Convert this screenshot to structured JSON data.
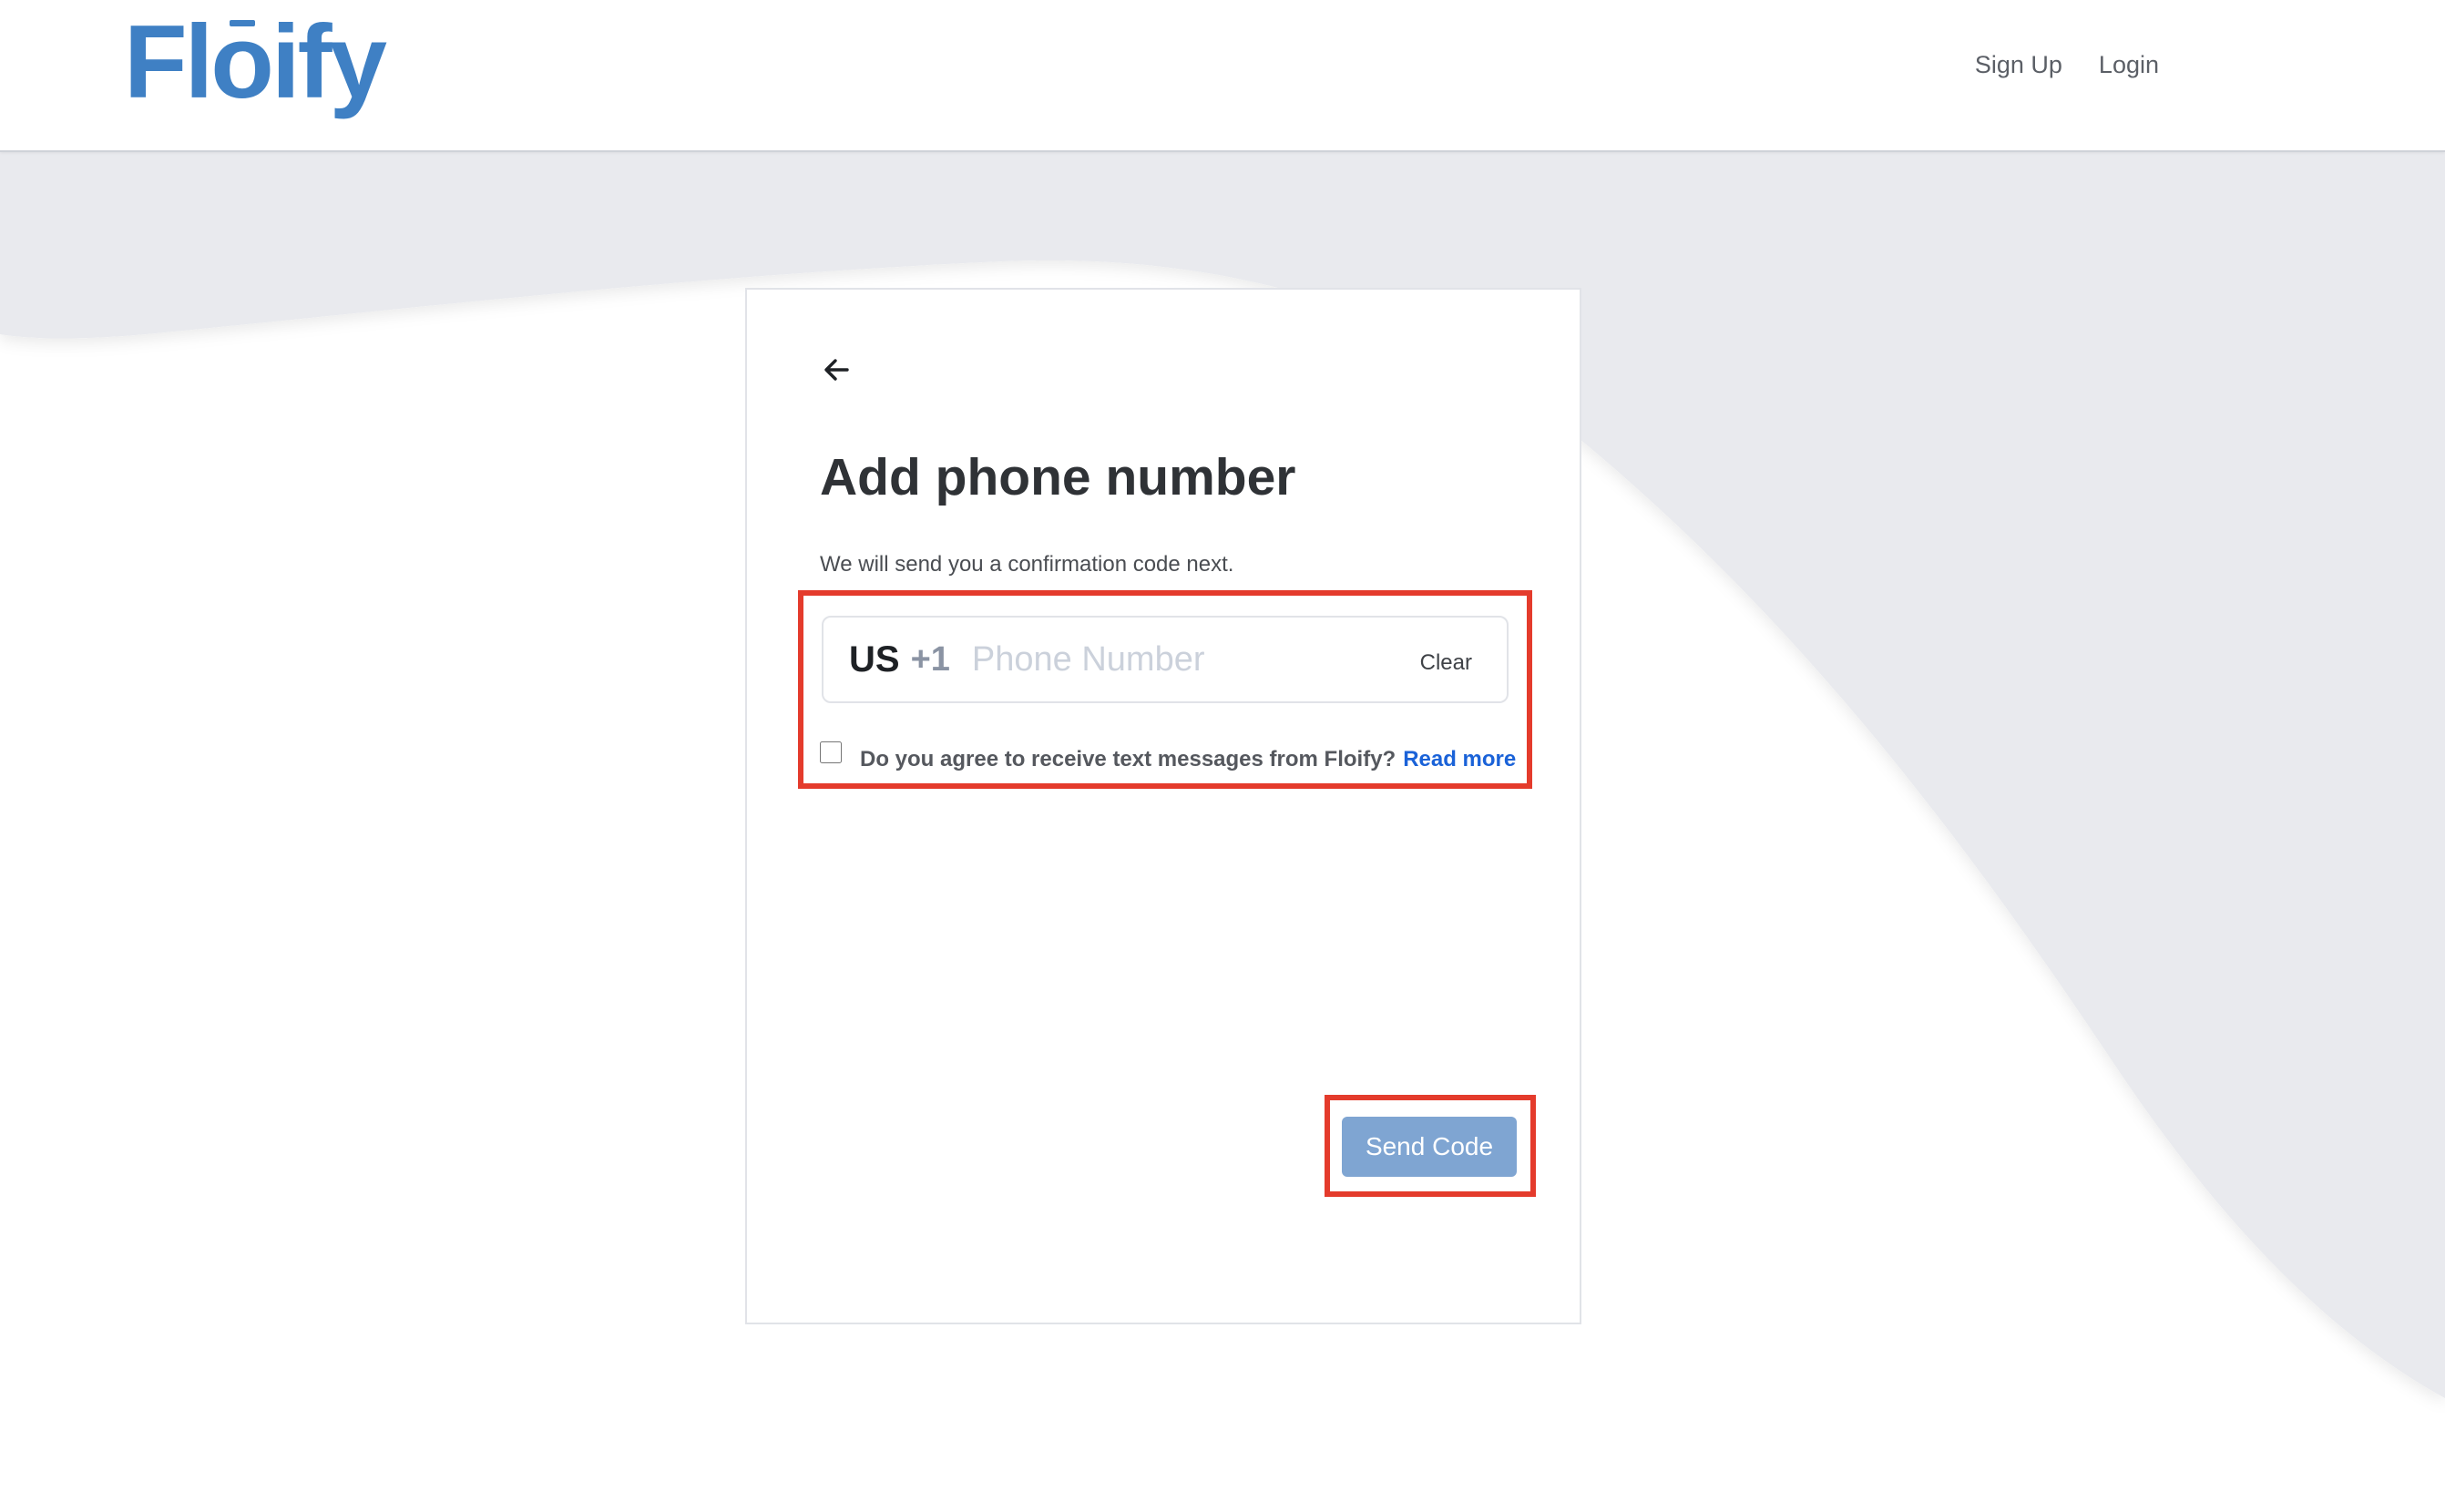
{
  "header": {
    "logo_text": "Floify",
    "nav": {
      "signup_label": "Sign Up",
      "login_label": "Login"
    }
  },
  "card": {
    "back_icon": "arrow-left-icon",
    "title": "Add phone number",
    "subtitle": "We will send you a confirmation code next.",
    "phone": {
      "country_code": "US",
      "dial_code": "+1",
      "value": "",
      "placeholder": "Phone Number",
      "clear_label": "Clear"
    },
    "consent": {
      "checked": false,
      "text": "Do you agree to receive text messages from Floify?",
      "link_label": "Read more"
    },
    "send_button_label": "Send Code"
  },
  "colors": {
    "brand": "#3f80c4",
    "button_disabled": "#7fa5d2",
    "link": "#1a62d8",
    "highlight": "#e43b2c",
    "background_wave": "#e9eaee"
  }
}
